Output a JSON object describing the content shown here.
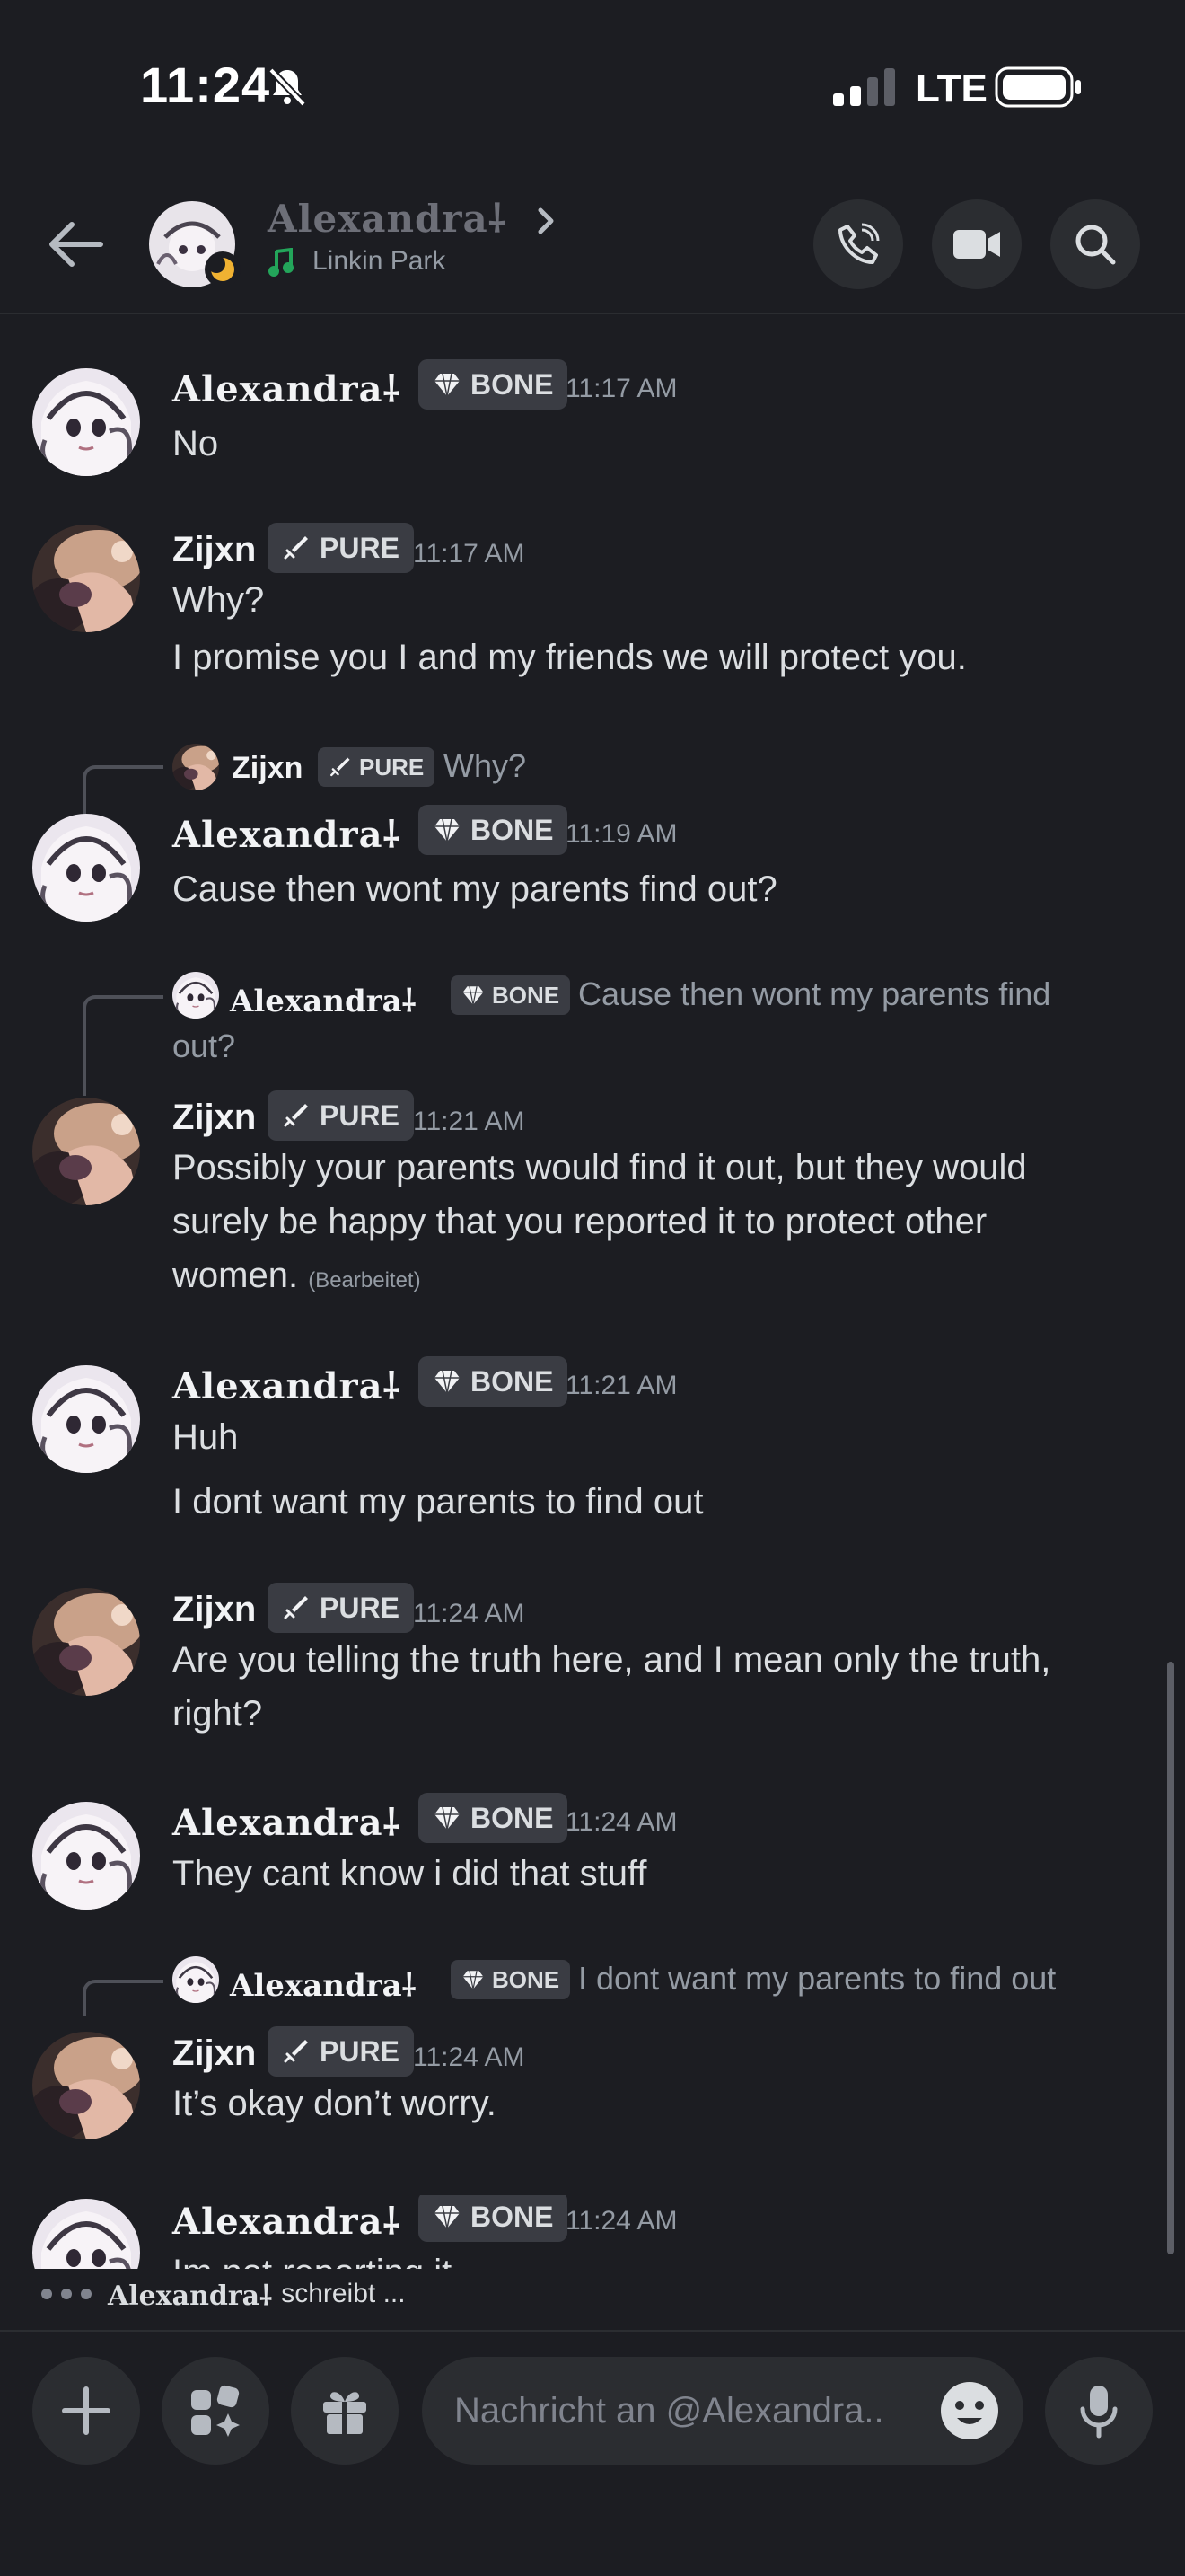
{
  "status_bar": {
    "time": "11:24",
    "network": "LTE"
  },
  "header": {
    "name": "Alexandra⸸",
    "status": "Linkin Park"
  },
  "messages": [
    {
      "author": "Alexandra⸸",
      "tag": "BONE",
      "time": "11:17 AM",
      "lines": [
        "No"
      ]
    },
    {
      "author": "Zijxn",
      "tag": "PURE",
      "time": "11:17 AM",
      "lines": [
        "Why?",
        "I promise you I and my friends we will protect you."
      ]
    },
    {
      "reply": {
        "author": "Zijxn",
        "tag": "PURE",
        "text": "Why?"
      },
      "author": "Alexandra⸸",
      "tag": "BONE",
      "time": "11:19 AM",
      "lines": [
        "Cause then wont my parents find out?"
      ]
    },
    {
      "reply": {
        "author": "Alexandra⸸",
        "tag": "BONE",
        "text_line1": "Cause then wont my parents find",
        "text_line2": "out?"
      },
      "author": "Zijxn",
      "tag": "PURE",
      "time": "11:21 AM",
      "lines": [
        "Possibly your parents would find it out, but they would",
        "surely be happy that you reported it to protect other",
        "women."
      ],
      "edited": "(Bearbeitet)"
    },
    {
      "author": "Alexandra⸸",
      "tag": "BONE",
      "time": "11:21 AM",
      "lines": [
        "Huh",
        "I dont want my parents to find out"
      ]
    },
    {
      "author": "Zijxn",
      "tag": "PURE",
      "time": "11:24 AM",
      "lines": [
        "Are you telling the truth here, and I mean only the truth,",
        "right?"
      ]
    },
    {
      "author": "Alexandra⸸",
      "tag": "BONE",
      "time": "11:24 AM",
      "lines": [
        "They cant know i did that stuff"
      ]
    },
    {
      "reply": {
        "author": "Alexandra⸸",
        "tag": "BONE",
        "text": "I dont want my parents to find out"
      },
      "author": "Zijxn",
      "tag": "PURE",
      "time": "11:24 AM",
      "lines": [
        "It’s okay don’t worry."
      ]
    },
    {
      "author": "Alexandra⸸",
      "tag": "BONE",
      "time": "11:24 AM",
      "lines": [
        "Im not reporting it"
      ]
    }
  ],
  "typing": {
    "name": "Alexandra⸸",
    "text": "schreibt ..."
  },
  "composer": {
    "placeholder": "Nachricht an @Alexandra.."
  },
  "colors": {
    "background": "#1c1d22",
    "surface": "#2b2d31",
    "music_green": "#23a55a",
    "moon": "#f0b232"
  }
}
